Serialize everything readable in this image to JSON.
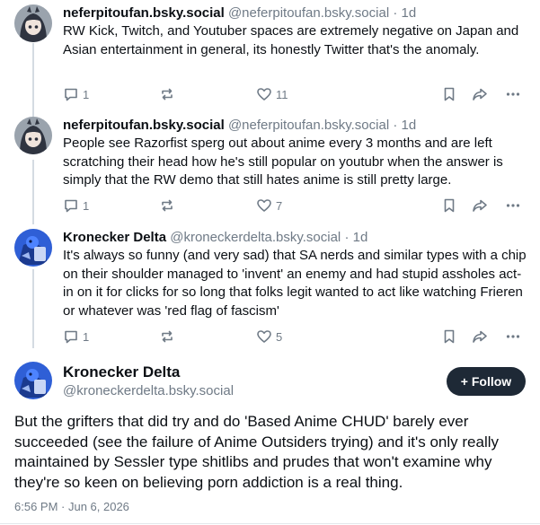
{
  "replies": [
    {
      "display_name": "neferpitoufan.bsky.social",
      "handle": "@neferpitoufan.bsky.social",
      "age": "· 1d",
      "text": "RW Kick, Twitch, and Youtuber spaces are extremely negative on Japan and Asian entertainment in general, its honestly Twitter that's the anomaly.",
      "reply_count": "1",
      "like_count": "11"
    },
    {
      "display_name": "neferpitoufan.bsky.social",
      "handle": "@neferpitoufan.bsky.social",
      "age": "· 1d",
      "text": "People see Razorfist sperg out about anime every 3 months and are left scratching their head how he's still popular on youtubr when the answer is simply that the RW demo that still hates anime is still pretty large.",
      "reply_count": "1",
      "like_count": "7"
    },
    {
      "display_name": "Kronecker Delta",
      "handle": "@kroneckerdelta.bsky.social",
      "age": "· 1d",
      "text": "It's always so funny (and very sad) that SA nerds and similar types with a chip on their shoulder managed to 'invent' an enemy and had stupid assholes act-in on it for clicks for so long that folks legit wanted to act like watching Frieren or whatever was 'red flag of fascism'",
      "reply_count": "1",
      "like_count": "5"
    }
  ],
  "main_post": {
    "display_name": "Kronecker Delta",
    "handle": "@kroneckerdelta.bsky.social",
    "follow_label": "+ Follow",
    "text": "But the grifters that did try and do 'Based Anime CHUD' barely ever succeeded (see the failure of Anime Outsiders trying) and it's only really maintained by Sessler type shitlibs and prudes that won't examine why they're so keen on believing porn addiction is a real thing.",
    "timestamp": "6:56 PM · Jun 6, 2026"
  },
  "colors": {
    "muted": "#6f7a86",
    "follow_bg": "#1e2936",
    "thread_line": "#d4dbe2"
  }
}
